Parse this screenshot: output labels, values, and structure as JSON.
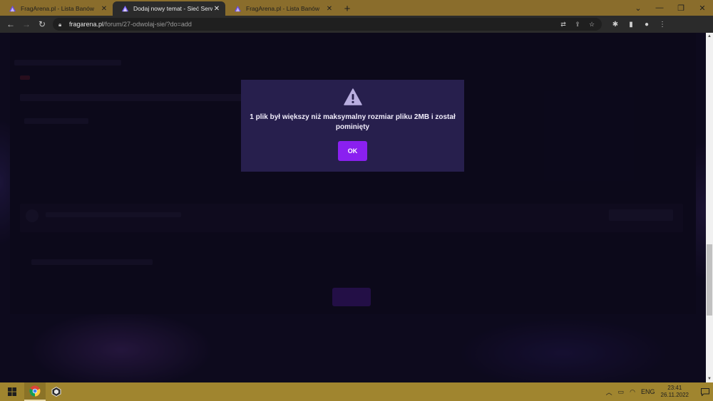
{
  "browser": {
    "tabs": [
      {
        "title": "FragArena.pl - Lista Banów",
        "active": false
      },
      {
        "title": "Dodaj nowy temat - Sieć Serwerów",
        "active": true
      },
      {
        "title": "FragArena.pl - Lista Banów",
        "active": false
      }
    ],
    "new_tab": "+",
    "url_host": "fragarena.pl",
    "url_path": "/forum/27-odwolaj-sie/?do=add"
  },
  "dialog": {
    "icon": "warning-triangle-icon",
    "message": "1 plik był większy niż maksymalny rozmiar pliku 2MB i został pominięty",
    "ok_label": "OK",
    "accent_color": "#8a20f0",
    "background_color": "#271f4d"
  },
  "taskbar": {
    "language": "ENG",
    "time": "23:41",
    "date": "26.11.2022"
  }
}
